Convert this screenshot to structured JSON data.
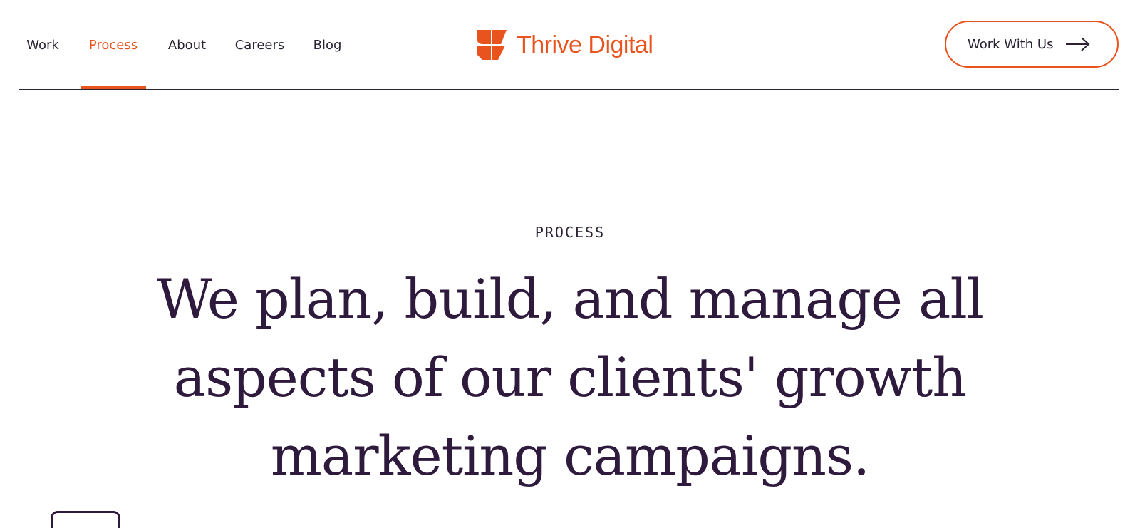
{
  "nav": {
    "items": [
      {
        "label": "Work"
      },
      {
        "label": "Process",
        "active": true
      },
      {
        "label": "About"
      },
      {
        "label": "Careers"
      },
      {
        "label": "Blog"
      }
    ]
  },
  "brand": {
    "name": "Thrive Digital",
    "logo_icon": "thrive-logo-mark",
    "color": "#e8531e"
  },
  "cta": {
    "label": "Work With Us",
    "icon": "arrow-right-icon"
  },
  "hero": {
    "eyebrow": "PROCESS",
    "headline": "We plan, build, and manage all aspects of our clients' growth marketing campaigns."
  },
  "colors": {
    "accent": "#e8531e",
    "text": "#2b2233",
    "headline": "#2e1a3c",
    "background": "#ffffff"
  }
}
